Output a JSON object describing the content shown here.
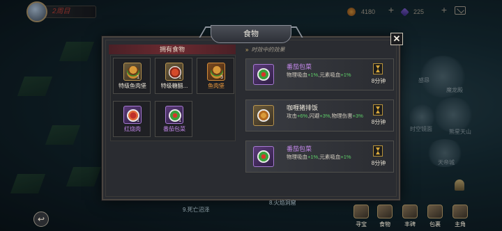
{
  "topbar": {
    "week_label": "2周目",
    "resource1_value": "4180",
    "resource2_value": "225"
  },
  "dialog": {
    "title": "食物",
    "close_symbol": "✕"
  },
  "owned": {
    "header": "拥有食物",
    "items": [
      {
        "name": "特级鱼肉堡",
        "qty": "1",
        "rarity": "gold",
        "dish": "burger"
      },
      {
        "name": "特级糖醋...",
        "qty": "1",
        "rarity": "gold",
        "dish": "crab"
      },
      {
        "name": "鱼肉堡",
        "qty": "3",
        "rarity": "orange",
        "dish": "burger"
      },
      {
        "name": "红烧肉",
        "qty": "1",
        "rarity": "purple",
        "dish": "meat"
      },
      {
        "name": "番茄包菜",
        "qty": "1",
        "rarity": "purple",
        "dish": "salad"
      }
    ]
  },
  "effects": {
    "header": "时效中的效果",
    "items": [
      {
        "name": "番茄包菜",
        "name_color": "purple",
        "desc_parts": [
          "物理吸血",
          "+1%",
          ",元素吸血",
          "+1%",
          ""
        ],
        "time": "8分钟",
        "dish": "salad",
        "rarity": "purple"
      },
      {
        "name": "咖喱猪排饭",
        "name_color": "white",
        "desc_parts": [
          "攻击",
          "+6%",
          ",闪避",
          "+3%",
          ",物理伤害",
          "+3%"
        ],
        "time": "8分钟",
        "dish": "curry",
        "rarity": "gold"
      },
      {
        "name": "番茄包菜",
        "name_color": "purple",
        "desc_parts": [
          "物理吸血",
          "+1%",
          ",元素吸血",
          "+1%",
          ""
        ],
        "time": "8分钟",
        "dish": "salad",
        "rarity": "purple"
      }
    ]
  },
  "map_labels": {
    "l1": "9.死亡沼泽",
    "l2": "8.火焰洞窟",
    "r1": "感昂",
    "r2": "魔龙殿",
    "r3": "时空镜面",
    "r4": "熊星天山",
    "r5": "天帝城"
  },
  "nav": {
    "items": [
      "寻宝",
      "食物",
      "丰碑",
      "包裹",
      "主角"
    ]
  },
  "icons": {
    "back": "↩",
    "chevron": "»",
    "plus": "+"
  }
}
